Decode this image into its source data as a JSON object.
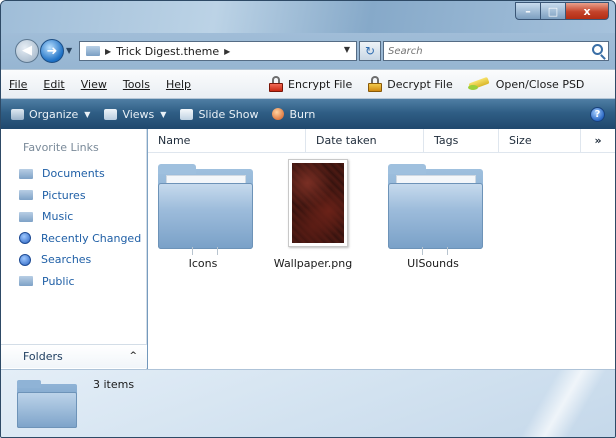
{
  "window": {
    "controls": {
      "minimize": "–",
      "maximize": "□",
      "close": "x"
    }
  },
  "address": {
    "path": "Trick Digest.theme",
    "back_glyph": "◀",
    "forward_glyph": "➜",
    "refresh_glyph": "↻",
    "search_placeholder": "Search"
  },
  "menubar": {
    "items": [
      "File",
      "Edit",
      "View",
      "Tools",
      "Help"
    ],
    "commands": [
      "Encrypt File",
      "Decrypt File",
      "Open/Close PSD"
    ]
  },
  "commandbar": {
    "items": [
      {
        "label": "Organize",
        "dropdown": true,
        "icon": "organize-icon"
      },
      {
        "label": "Views",
        "dropdown": true,
        "icon": "views-icon"
      },
      {
        "label": "Slide Show",
        "dropdown": false,
        "icon": "slideshow-icon"
      },
      {
        "label": "Burn",
        "dropdown": false,
        "icon": "burn-icon"
      }
    ],
    "help_glyph": "?"
  },
  "navpane": {
    "title": "Favorite Links",
    "links": [
      {
        "label": "Documents",
        "icon": "folder-icon"
      },
      {
        "label": "Pictures",
        "icon": "folder-icon"
      },
      {
        "label": "Music",
        "icon": "folder-icon"
      },
      {
        "label": "Recently Changed",
        "icon": "search-folder-icon"
      },
      {
        "label": "Searches",
        "icon": "search-folder-icon"
      },
      {
        "label": "Public",
        "icon": "folder-icon"
      }
    ],
    "folders_label": "Folders",
    "folders_chevron": "^"
  },
  "columns": [
    "Name",
    "Date taken",
    "Tags",
    "Size",
    "»"
  ],
  "files": [
    {
      "name": "Icons",
      "type": "folder"
    },
    {
      "name": "Wallpaper.png",
      "type": "image"
    },
    {
      "name": "UISounds",
      "type": "folder"
    }
  ],
  "details": {
    "count": "3 items"
  },
  "colors": {
    "link_blue": "#1f5fa6",
    "commandbar_dark": "#20486d",
    "close_red": "#c4432a"
  }
}
